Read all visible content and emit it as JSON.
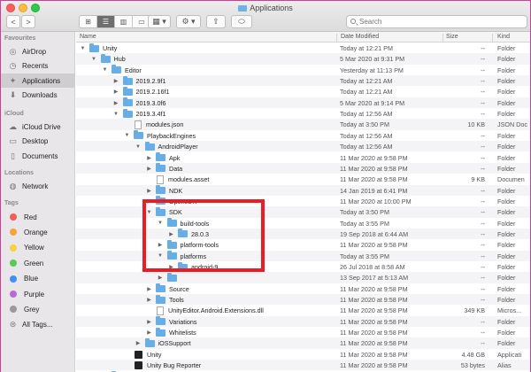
{
  "window": {
    "title": "Applications"
  },
  "toolbar": {
    "back": "<",
    "forward": ">",
    "action": "⚙ ▾",
    "share": "⇪",
    "search_placeholder": "Search"
  },
  "sidebar": {
    "favourites_header": "Favourites",
    "favourites": [
      {
        "label": "AirDrop",
        "icon": "airdrop-icon",
        "glyph": "◎"
      },
      {
        "label": "Recents",
        "icon": "clock-icon",
        "glyph": "◷"
      },
      {
        "label": "Applications",
        "icon": "applications-icon",
        "glyph": "✦",
        "selected": true
      },
      {
        "label": "Downloads",
        "icon": "download-icon",
        "glyph": "⬇"
      }
    ],
    "icloud_header": "iCloud",
    "icloud": [
      {
        "label": "iCloud Drive",
        "icon": "cloud-icon",
        "glyph": "☁"
      },
      {
        "label": "Desktop",
        "icon": "desktop-icon",
        "glyph": "▭"
      },
      {
        "label": "Documents",
        "icon": "documents-icon",
        "glyph": "▯"
      }
    ],
    "locations_header": "Locations",
    "locations": [
      {
        "label": "Network",
        "icon": "globe-icon",
        "glyph": "◍"
      }
    ],
    "tags_header": "Tags",
    "tags": [
      {
        "label": "Red",
        "color": "#f55c57"
      },
      {
        "label": "Orange",
        "color": "#f7a23a"
      },
      {
        "label": "Yellow",
        "color": "#f6d23c"
      },
      {
        "label": "Green",
        "color": "#5dc852"
      },
      {
        "label": "Blue",
        "color": "#3f8ff7"
      },
      {
        "label": "Purple",
        "color": "#b86ad7"
      },
      {
        "label": "Grey",
        "color": "#9a9a9e"
      },
      {
        "label": "All Tags...",
        "color": "",
        "icon": "all-tags-icon",
        "glyph": "⊜"
      }
    ]
  },
  "columns": {
    "name": "Name",
    "date": "Date Modified",
    "size": "Size",
    "kind": "Kind"
  },
  "rows": [
    {
      "depth": 0,
      "disc": "open",
      "icon": "folder",
      "name": "Unity",
      "date": "Today at 12:21 PM",
      "size": "--",
      "kind": "Folder"
    },
    {
      "depth": 1,
      "disc": "open",
      "icon": "folder",
      "name": "Hub",
      "date": "5 Mar 2020 at 9:31 PM",
      "size": "--",
      "kind": "Folder"
    },
    {
      "depth": 2,
      "disc": "open",
      "icon": "folder",
      "name": "Editor",
      "date": "Yesterday at 11:13 PM",
      "size": "--",
      "kind": "Folder"
    },
    {
      "depth": 3,
      "disc": "closed",
      "icon": "folder",
      "name": "2019.2.9f1",
      "date": "Today at 12:21 AM",
      "size": "--",
      "kind": "Folder"
    },
    {
      "depth": 3,
      "disc": "closed",
      "icon": "folder",
      "name": "2019.2.16f1",
      "date": "Today at 12:21 AM",
      "size": "--",
      "kind": "Folder"
    },
    {
      "depth": 3,
      "disc": "closed",
      "icon": "folder",
      "name": "2019.3.0f6",
      "date": "5 Mar 2020 at 9:14 PM",
      "size": "--",
      "kind": "Folder"
    },
    {
      "depth": 3,
      "disc": "open",
      "icon": "folder",
      "name": "2019.3.4f1",
      "date": "Today at 12:56 AM",
      "size": "--",
      "kind": "Folder"
    },
    {
      "depth": 4,
      "disc": "none",
      "icon": "doc",
      "name": "modules.json",
      "date": "Today at 3:50 PM",
      "size": "10 KB",
      "kind": "JSON Doc"
    },
    {
      "depth": 4,
      "disc": "open",
      "icon": "folder",
      "name": "PlaybackEngines",
      "date": "Today at 12:56 AM",
      "size": "--",
      "kind": "Folder"
    },
    {
      "depth": 5,
      "disc": "open",
      "icon": "folder",
      "name": "AndroidPlayer",
      "date": "Today at 12:56 AM",
      "size": "--",
      "kind": "Folder"
    },
    {
      "depth": 6,
      "disc": "closed",
      "icon": "folder",
      "name": "Apk",
      "date": "11 Mar 2020 at 9:58 PM",
      "size": "--",
      "kind": "Folder"
    },
    {
      "depth": 6,
      "disc": "closed",
      "icon": "folder",
      "name": "Data",
      "date": "11 Mar 2020 at 9:58 PM",
      "size": "--",
      "kind": "Folder"
    },
    {
      "depth": 6,
      "disc": "none",
      "icon": "doc",
      "name": "modules.asset",
      "date": "11 Mar 2020 at 9:58 PM",
      "size": "9 KB",
      "kind": "Documen"
    },
    {
      "depth": 6,
      "disc": "closed",
      "icon": "folder",
      "name": "NDK",
      "date": "14 Jan 2019 at 6:41 PM",
      "size": "--",
      "kind": "Folder"
    },
    {
      "depth": 6,
      "disc": "closed",
      "icon": "folder",
      "name": "OpenJDK",
      "date": "11 Mar 2020 at 10:00 PM",
      "size": "--",
      "kind": "Folder"
    },
    {
      "depth": 6,
      "disc": "open",
      "icon": "folder",
      "name": "SDK",
      "date": "Today at 3:50 PM",
      "size": "--",
      "kind": "Folder"
    },
    {
      "depth": 7,
      "disc": "open",
      "icon": "folder",
      "name": "build-tools",
      "date": "Today at 3:55 PM",
      "size": "--",
      "kind": "Folder"
    },
    {
      "depth": 8,
      "disc": "closed",
      "icon": "folder",
      "name": "28.0.3",
      "date": "19 Sep 2018 at 6:44 AM",
      "size": "--",
      "kind": "Folder"
    },
    {
      "depth": 7,
      "disc": "closed",
      "icon": "folder",
      "name": "platform-tools",
      "date": "11 Mar 2020 at 9:58 PM",
      "size": "--",
      "kind": "Folder"
    },
    {
      "depth": 7,
      "disc": "open",
      "icon": "folder",
      "name": "platforms",
      "date": "Today at 3:55 PM",
      "size": "--",
      "kind": "Folder"
    },
    {
      "depth": 8,
      "disc": "closed",
      "icon": "folder",
      "name": "android-9",
      "date": "26 Jul 2018 at 8:58 AM",
      "size": "--",
      "kind": "Folder"
    },
    {
      "depth": 7,
      "disc": "closed",
      "icon": "folder",
      "name": "",
      "date": "13 Sep 2017 at 5:13 AM",
      "size": "--",
      "kind": "Folder"
    },
    {
      "depth": 6,
      "disc": "closed",
      "icon": "folder",
      "name": "Source",
      "date": "11 Mar 2020 at 9:58 PM",
      "size": "--",
      "kind": "Folder"
    },
    {
      "depth": 6,
      "disc": "closed",
      "icon": "folder",
      "name": "Tools",
      "date": "11 Mar 2020 at 9:58 PM",
      "size": "--",
      "kind": "Folder"
    },
    {
      "depth": 6,
      "disc": "none",
      "icon": "doc",
      "name": "UnityEditor.Android.Extensions.dll",
      "date": "11 Mar 2020 at 9:58 PM",
      "size": "349 KB",
      "kind": "Micros..."
    },
    {
      "depth": 6,
      "disc": "closed",
      "icon": "folder",
      "name": "Variations",
      "date": "11 Mar 2020 at 9:58 PM",
      "size": "--",
      "kind": "Folder"
    },
    {
      "depth": 6,
      "disc": "closed",
      "icon": "folder",
      "name": "Whitelists",
      "date": "11 Mar 2020 at 9:58 PM",
      "size": "--",
      "kind": "Folder"
    },
    {
      "depth": 5,
      "disc": "closed",
      "icon": "folder",
      "name": "iOSSupport",
      "date": "11 Mar 2020 at 9:58 PM",
      "size": "--",
      "kind": "Folder"
    },
    {
      "depth": 4,
      "disc": "none",
      "icon": "app",
      "name": "Unity",
      "date": "11 Mar 2020 at 9:58 PM",
      "size": "4.48 GB",
      "kind": "Applicati"
    },
    {
      "depth": 4,
      "disc": "none",
      "icon": "app",
      "name": "Unity Bug Reporter",
      "date": "11 Mar 2020 at 9:58 PM",
      "size": "53 bytes",
      "kind": "Alias"
    },
    {
      "depth": 2,
      "disc": "none",
      "icon": "folder",
      "name": "",
      "date": "11 Mar 2020 at 9:58 PM",
      "size": "",
      "kind": ""
    }
  ]
}
